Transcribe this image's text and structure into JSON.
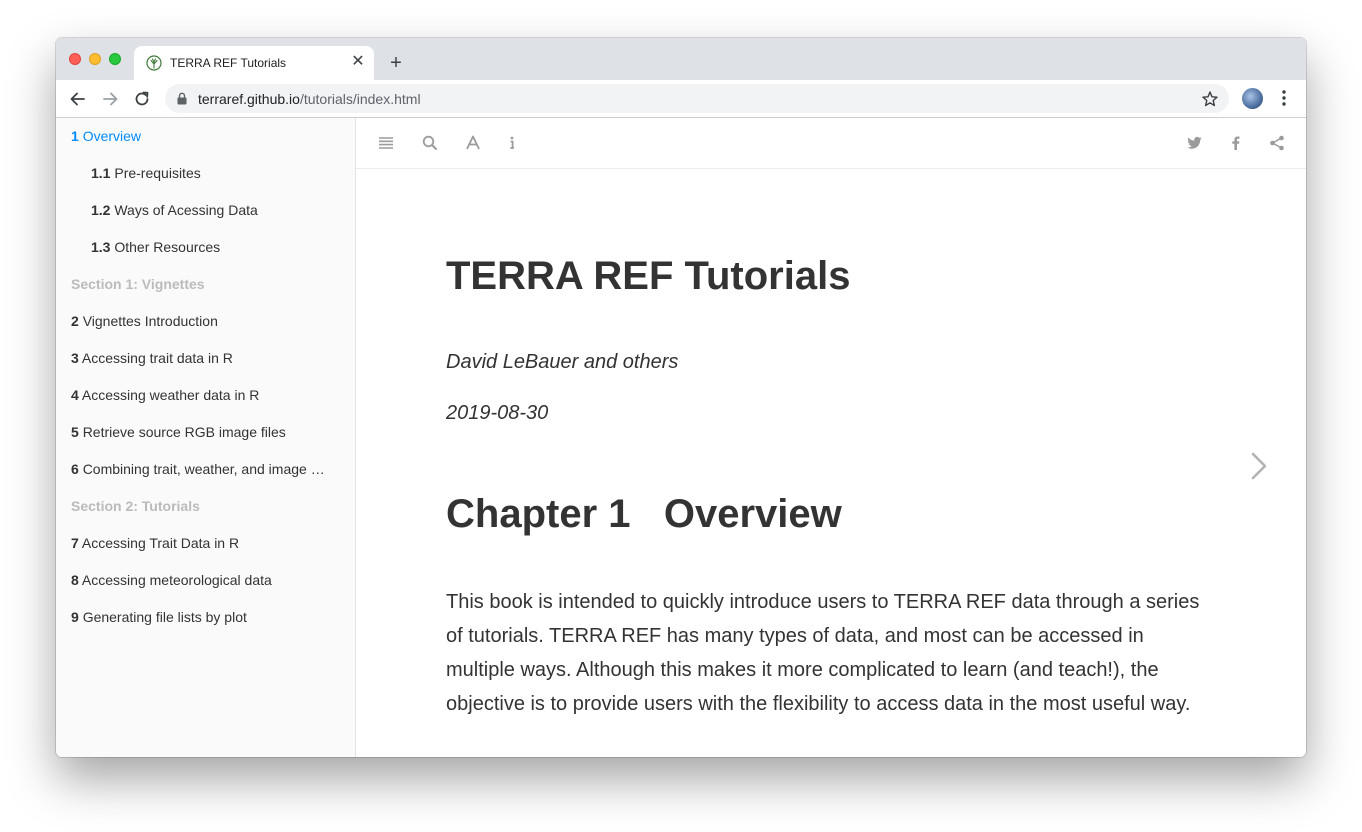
{
  "browser": {
    "tab": {
      "title": "TERRA REF Tutorials"
    },
    "new_tab_label": "+",
    "address": {
      "host": "terraref.github.io",
      "path": "/tutorials/index.html"
    }
  },
  "sidebar": {
    "items": [
      {
        "num": "1",
        "label": "Overview",
        "kind": "chapter",
        "active": true
      },
      {
        "num": "1.1",
        "label": "Pre-requisites",
        "kind": "sub"
      },
      {
        "num": "1.2",
        "label": "Ways of Acessing Data",
        "kind": "sub"
      },
      {
        "num": "1.3",
        "label": "Other Resources",
        "kind": "sub"
      },
      {
        "num": "",
        "label": "Section 1: Vignettes",
        "kind": "header"
      },
      {
        "num": "2",
        "label": "Vignettes Introduction",
        "kind": "chapter"
      },
      {
        "num": "3",
        "label": "Accessing trait data in R",
        "kind": "chapter"
      },
      {
        "num": "4",
        "label": "Accessing weather data in R",
        "kind": "chapter"
      },
      {
        "num": "5",
        "label": "Retrieve source RGB image files",
        "kind": "chapter"
      },
      {
        "num": "6",
        "label": "Combining trait, weather, and image …",
        "kind": "chapter"
      },
      {
        "num": "",
        "label": "Section 2: Tutorials",
        "kind": "header"
      },
      {
        "num": "7",
        "label": "Accessing Trait Data in R",
        "kind": "chapter"
      },
      {
        "num": "8",
        "label": "Accessing meteorological data",
        "kind": "chapter"
      },
      {
        "num": "9",
        "label": "Generating file lists by plot",
        "kind": "chapter"
      }
    ]
  },
  "book_toolbar": {
    "left_icons": [
      "toc-toggle-icon",
      "search-icon",
      "font-settings-icon",
      "info-icon"
    ],
    "right_icons": [
      "twitter-icon",
      "facebook-icon",
      "share-icon"
    ]
  },
  "content": {
    "title": "TERRA REF Tutorials",
    "author": "David LeBauer and others",
    "date": "2019-08-30",
    "chapter_title": "Chapter 1   Overview",
    "intro": "This book is intended to quickly introduce users to TERRA REF data through a series of tutorials. TERRA REF has many types of data, and most can be accessed in multiple ways. Although this makes it more complicated to learn (and teach!), the objective is to provide users with the flexibility to access data in the most useful way."
  },
  "colors": {
    "accent": "#008cff",
    "text": "#333333",
    "section_header": "#bbbbbb",
    "sidebar_bg": "#fafafa",
    "tabstrip_bg": "#dee1e6"
  }
}
